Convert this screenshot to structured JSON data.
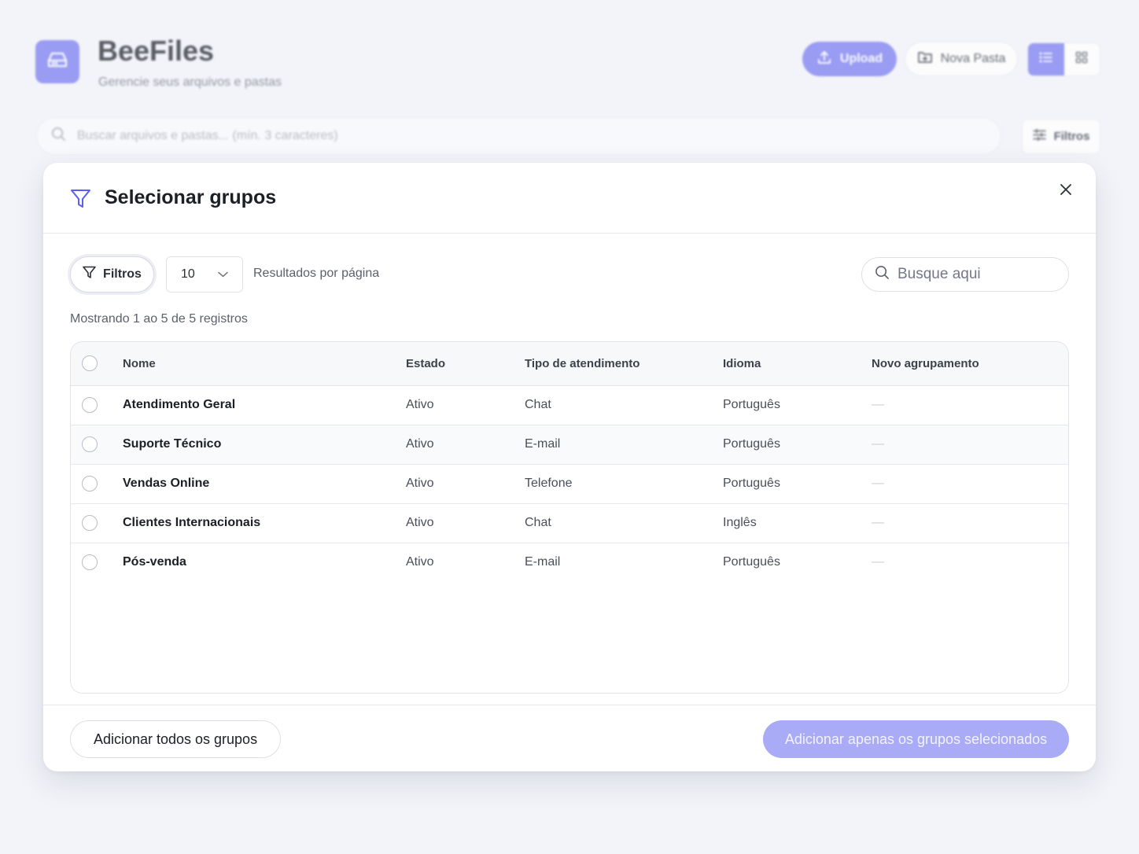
{
  "app": {
    "title": "BeeFiles",
    "subtitle": "Gerencie seus arquivos e pastas",
    "upload_label": "Upload",
    "new_folder_label": "Nova Pasta",
    "search_placeholder": "Buscar arquivos e pastas... (mín. 3 caracteres)",
    "filters_label": "Filtros",
    "view_mode": "list"
  },
  "modal": {
    "title": "Selecionar grupos",
    "filters_button": "Filtros",
    "per_page_value": "10",
    "per_page_label": "Resultados por página",
    "search_placeholder": "Busque aqui",
    "records_info": "Mostrando 1 ao 5 de 5 registros",
    "columns": [
      "Nome",
      "Estado",
      "Tipo de atendimento",
      "Idioma",
      "Novo agrupamento"
    ],
    "rows": [
      {
        "nome": "Atendimento Geral",
        "estado": "Ativo",
        "tipo": "Chat",
        "idioma": "Português",
        "agrupamento": "—"
      },
      {
        "nome": "Suporte Técnico",
        "estado": "Ativo",
        "tipo": "E-mail",
        "idioma": "Português",
        "agrupamento": "—"
      },
      {
        "nome": "Vendas Online",
        "estado": "Ativo",
        "tipo": "Telefone",
        "idioma": "Português",
        "agrupamento": "—"
      },
      {
        "nome": "Clientes Internacionais",
        "estado": "Ativo",
        "tipo": "Chat",
        "idioma": "Inglês",
        "agrupamento": "—"
      },
      {
        "nome": "Pós-venda",
        "estado": "Ativo",
        "tipo": "E-mail",
        "idioma": "Português",
        "agrupamento": "—"
      }
    ],
    "add_all_label": "Adicionar todos os grupos",
    "add_selected_label": "Adicionar apenas os grupos selecionados"
  },
  "colors": {
    "accent": "#7b7ff0",
    "accent_disabled": "#a9abf6",
    "filter_icon": "#5b5ff0"
  },
  "icons": [
    "drive-icon",
    "upload-icon",
    "folder-plus-icon",
    "list-icon",
    "grid-icon",
    "search-icon",
    "sliders-icon",
    "filter-icon",
    "close-icon",
    "chevron-down-icon"
  ]
}
